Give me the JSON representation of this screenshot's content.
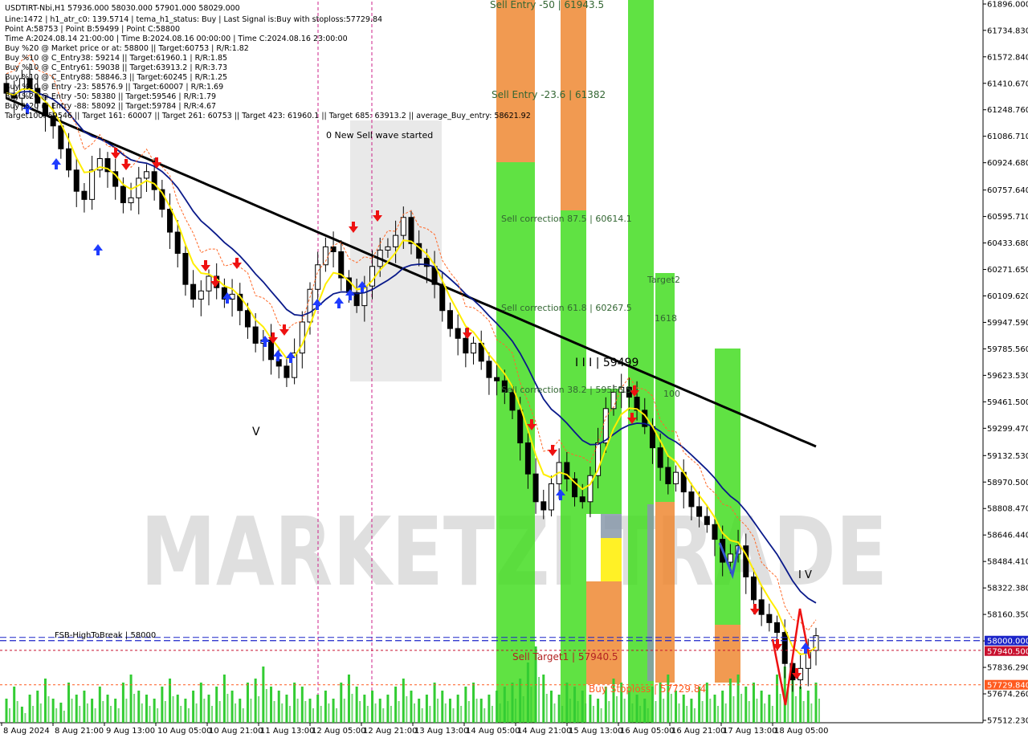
{
  "header": {
    "lines": [
      "USDTIRT-Nbi,H1  57936.000 58030.000 57901.000 58029.000",
      "Line:1472 | h1_atr_c0: 139.5714 | tema_h1_status: Buy | Last Signal is:Buy with stoploss:57729.84",
      "Point A:58753 | Point B:59499 | Point C:58800",
      "Time A:2024.08.14 21:00:00 | Time B:2024.08.16 00:00:00 | Time C:2024.08.16 23:00:00",
      "Buy %20 @ Market price or at: 58800 || Target:60753 | R/R:1.82",
      "Buy %10 @ C_Entry38: 59214 || Target:61960.1 | R/R:1.85",
      "Buy %10 @ C_Entry61: 59038 || Target:63913.2 | R/R:3.73",
      "Buy %10 @ C_Entry88: 58846.3 || Target:60245 | R/R:1.25",
      "Buy %10 @ Entry -23: 58576.9 || Target:60007 | R/R:1.69",
      "Buy %20 @ Entry -50: 58380 || Target:59546 | R/R:1.79",
      "Buy %20 @ Entry -88: 58092 || Target:59784 | R/R:4.67",
      "Target100: 59546 || Target 161: 60007 || Target 261: 60753 || Target 423: 61960.1 || Target 685: 63913.2 || average_Buy_entry: 58621.92"
    ]
  },
  "annotations": {
    "new_wave": "0 New Sell wave started",
    "sell_entry_50": "Sell Entry -50 | 61943.5",
    "sell_entry_23": "Sell Entry -23.6 | 61382",
    "sell_corr_875": "Sell correction 87.5 | 60614.1",
    "sell_corr_618": "Sell correction 61.8 | 60267.5",
    "sell_corr_382": "Sell correction 38.2 | 59565.5",
    "wave_iii": "I I I | 59499",
    "target2": "Target2",
    "num_1618": "1618",
    "num_100": "100",
    "wave_v": "V",
    "wave_iv": "I V",
    "fsb_label": "FSB-HighToBreak | 58000",
    "sell_target1": "Sell Target1 | 57940.5",
    "buy_stoploss": "Buy Stoploss | 57729.84",
    "watermark": "MARKETZI TRADE"
  },
  "chart_data": {
    "type": "candlestick",
    "symbol": "USDTIRT-Nbi",
    "timeframe": "H1",
    "y_ticks": [
      61896.0,
      61734.83,
      61572.84,
      61410.67,
      61248.76,
      61086.71,
      60924.68,
      60757.64,
      60595.71,
      60433.68,
      60271.65,
      60109.62,
      59947.59,
      59785.56,
      59623.53,
      59461.5,
      59299.47,
      59132.53,
      58970.5,
      58808.47,
      58646.44,
      58484.41,
      58322.38,
      58160.35,
      57998.32,
      57836.29,
      57674.26,
      57512.23
    ],
    "x_ticks": [
      "8 Aug 2024",
      "8 Aug 21:00",
      "9 Aug 13:00",
      "10 Aug 05:00",
      "10 Aug 21:00",
      "11 Aug 13:00",
      "12 Aug 05:00",
      "12 Aug 21:00",
      "13 Aug 13:00",
      "14 Aug 05:00",
      "14 Aug 21:00",
      "15 Aug 13:00",
      "16 Aug 05:00",
      "16 Aug 21:00",
      "17 Aug 13:00",
      "18 Aug 05:00"
    ],
    "ylim": [
      57470,
      61915
    ],
    "price_badges": [
      {
        "label": "58000.000",
        "value": 58000,
        "bg": "#1c25c9"
      },
      {
        "label": "57940.500",
        "value": 57940.5,
        "bg": "#c8102e"
      },
      {
        "label": "57729.840",
        "value": 57729.84,
        "bg": "#ff5a1f"
      }
    ],
    "levels": {
      "fsb_high_to_break": 58000,
      "sell_target1": 57940.5,
      "buy_stoploss": 57729.84
    },
    "closes": [
      61350,
      61320,
      61440,
      61380,
      61290,
      61210,
      61150,
      61010,
      60880,
      60750,
      60700,
      60880,
      60950,
      60870,
      60780,
      60680,
      60710,
      60830,
      60870,
      60760,
      60640,
      60500,
      60370,
      60180,
      60090,
      60140,
      60230,
      60160,
      60090,
      60120,
      60020,
      59920,
      59820,
      59840,
      59720,
      59680,
      59610,
      59760,
      59950,
      60150,
      60300,
      60410,
      60380,
      60220,
      60130,
      60050,
      60170,
      60290,
      60390,
      60410,
      60480,
      60590,
      60430,
      60340,
      60290,
      60180,
      60020,
      59910,
      59850,
      59760,
      59820,
      59710,
      59610,
      59590,
      59520,
      59410,
      59210,
      59020,
      58850,
      58800,
      58960,
      59090,
      58990,
      58880,
      58850,
      59010,
      59210,
      59420,
      59520,
      59550,
      59490,
      59410,
      59310,
      59180,
      59060,
      58960,
      59030,
      58910,
      58820,
      58760,
      58710,
      58620,
      58480,
      58530,
      58580,
      58390,
      58250,
      58160,
      58110,
      58050,
      57860,
      57760,
      57830,
      57940,
      58030
    ],
    "volume": [
      0.3,
      0.45,
      0.2,
      0.35,
      0.4,
      0.55,
      0.3,
      0.25,
      0.5,
      0.35,
      0.4,
      0.3,
      0.45,
      0.35,
      0.3,
      0.5,
      0.6,
      0.4,
      0.35,
      0.3,
      0.45,
      0.55,
      0.35,
      0.3,
      0.4,
      0.5,
      0.35,
      0.45,
      0.6,
      0.4,
      0.3,
      0.5,
      0.55,
      0.7,
      0.45,
      0.4,
      0.35,
      0.5,
      0.45,
      0.3,
      0.35,
      0.4,
      0.3,
      0.5,
      0.6,
      0.45,
      0.35,
      0.4,
      0.3,
      0.35,
      0.45,
      0.55,
      0.4,
      0.3,
      0.35,
      0.5,
      0.4,
      0.3,
      0.35,
      0.45,
      0.5,
      0.3,
      0.35,
      0.4,
      0.45,
      0.5,
      0.55,
      0.75,
      0.95,
      0.6,
      0.4,
      0.35,
      0.5,
      0.45,
      0.4,
      0.35,
      0.3,
      0.45,
      0.55,
      0.5,
      0.4,
      0.35,
      0.3,
      0.45,
      0.5,
      0.6,
      0.4,
      0.35,
      0.3,
      0.45,
      0.5,
      0.35,
      0.4,
      0.55,
      0.6,
      0.45,
      0.5,
      0.4,
      0.35,
      0.6,
      0.7,
      0.55,
      0.45,
      0.4,
      0.5
    ],
    "colors": {
      "candle": "#000000",
      "ema_yellow": "#ffee00",
      "ema_blue": "#0a1a8a",
      "ema_black": "#000000",
      "volume": "#33cc33",
      "zone_green": "#44dd22",
      "zone_orange": "#ee8833",
      "zone_gray": "#8899aa",
      "zone_yellow": "#ffee00",
      "buy_arrow": "#1f3cff",
      "sell_arrow": "#ee1111"
    }
  }
}
